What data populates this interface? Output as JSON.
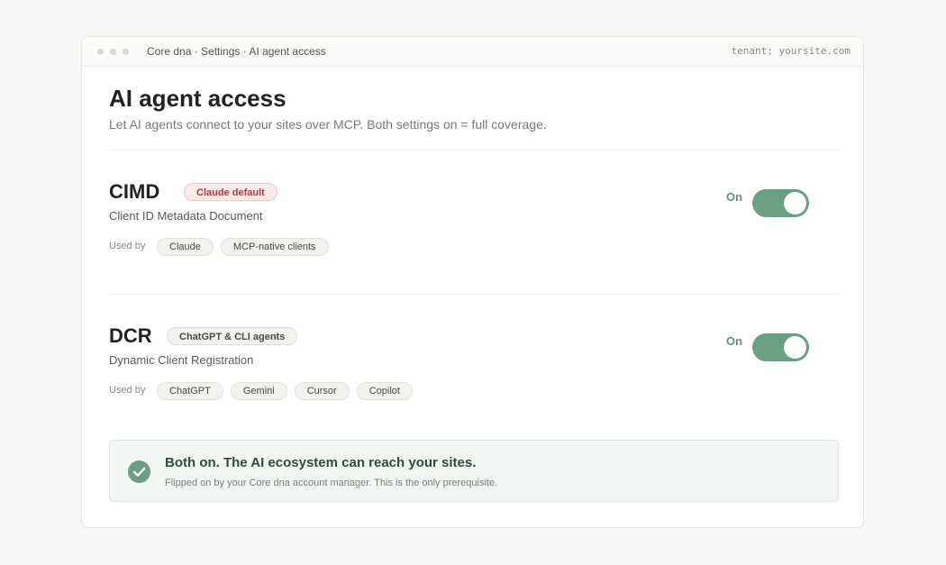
{
  "titlebar": {
    "breadcrumb": "Core dna · Settings · AI agent access",
    "tenant": "tenant: yoursite.com"
  },
  "page": {
    "title": "AI agent access",
    "subtitle": "Let AI agents connect to your sites over MCP. Both settings on = full coverage."
  },
  "cimd": {
    "name": "CIMD",
    "tag": "Claude default",
    "description": "Client ID Metadata Document",
    "used_by_label": "Used by",
    "clients": [
      "Claude",
      "MCP-native clients"
    ],
    "toggle_state": "On",
    "enabled": true
  },
  "dcr": {
    "name": "DCR",
    "tag": "ChatGPT & CLI agents",
    "description": "Dynamic Client Registration",
    "used_by_label": "Used by",
    "clients": [
      "ChatGPT",
      "Gemini",
      "Cursor",
      "Copilot"
    ],
    "toggle_state": "On",
    "enabled": true
  },
  "banner": {
    "icon": "check-circle-icon",
    "title": "Both on. The AI ecosystem can reach your sites.",
    "description": "Flipped on by your Core dna account manager. This is the only prerequisite."
  },
  "colors": {
    "accent_green": "#6a9f82",
    "tag_red": "#b83a2e"
  }
}
